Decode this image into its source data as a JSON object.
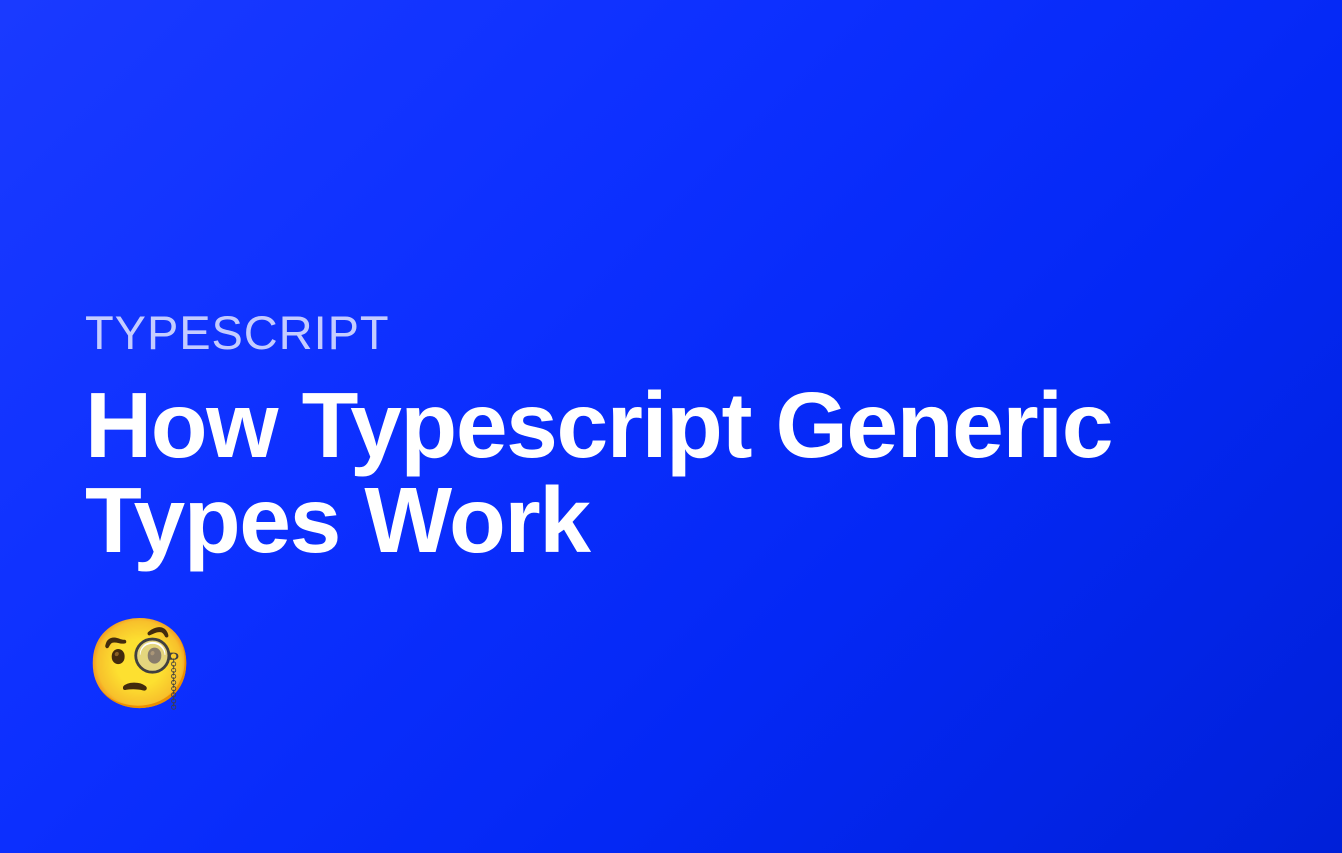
{
  "category": "TYPESCRIPT",
  "title": "How Typescript Generic Types Work",
  "emoji": "🧐"
}
